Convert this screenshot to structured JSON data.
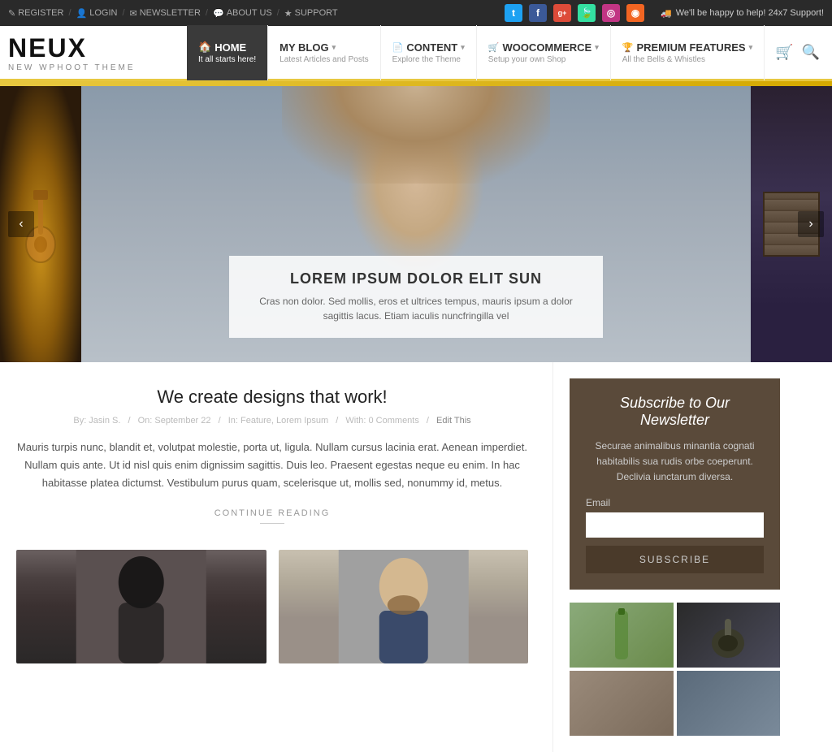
{
  "topbar": {
    "links": [
      {
        "label": "REGISTER",
        "icon": "✎"
      },
      {
        "label": "LOGIN",
        "icon": "👤"
      },
      {
        "label": "NEWSLETTER",
        "icon": "✉"
      },
      {
        "label": "ABOUT US",
        "icon": "💬"
      },
      {
        "label": "SUPPORT",
        "icon": "★"
      }
    ],
    "social": [
      {
        "name": "twitter",
        "icon": "t",
        "class": "si-twitter"
      },
      {
        "name": "facebook",
        "icon": "f",
        "class": "si-facebook"
      },
      {
        "name": "google",
        "icon": "g+",
        "class": "si-google"
      },
      {
        "name": "tripadvisor",
        "icon": "🍃",
        "class": "si-tripadvisor"
      },
      {
        "name": "instagram",
        "icon": "◎",
        "class": "si-instagram"
      },
      {
        "name": "rss",
        "icon": "◉",
        "class": "si-rss"
      }
    ],
    "support_text": "We'll be happy to help! 24x7 Support!"
  },
  "nav": {
    "logo": "NEUX",
    "tagline": "NEW WPHOOT THEME",
    "items": [
      {
        "label": "HOME",
        "sub": "It all starts here!",
        "active": true,
        "icon": "🏠"
      },
      {
        "label": "MY BLOG",
        "sub": "Latest Articles and Posts",
        "dropdown": true,
        "icon": ""
      },
      {
        "label": "CONTENT",
        "sub": "Explore the Theme",
        "dropdown": true,
        "icon": "📄"
      },
      {
        "label": "WOOCOMMERCE",
        "sub": "Setup your own Shop",
        "dropdown": true,
        "icon": "🛒"
      },
      {
        "label": "PREMIUM FEATURES",
        "sub": "All the Bells & Whistles",
        "dropdown": true,
        "icon": "🏆"
      }
    ]
  },
  "hero": {
    "title": "LOREM IPSUM DOLOR ELIT SUN",
    "description": "Cras non dolor. Sed mollis, eros et ultrices tempus, mauris ipsum a dolor sagittis lacus. Etiam iaculis nuncfringilla vel"
  },
  "article": {
    "title": "We create designs that work!",
    "meta": {
      "author": "By: Jasin S.",
      "date": "On: September 22",
      "category": "In: Feature, Lorem Ipsum",
      "comments": "With: 0 Comments",
      "edit": "Edit This"
    },
    "body": "Mauris turpis nunc, blandit et, volutpat molestie, porta ut, ligula. Nullam cursus lacinia erat. Aenean imperdiet. Nullam quis ante. Ut id nisl quis enim dignissim sagittis. Duis leo. Praesent egestas neque eu enim. In hac habitasse platea dictumst. Vestibulum purus quam, scelerisque ut, mollis sed, nonummy id, metus.",
    "continue_label": "CONTINUE READING"
  },
  "newsletter": {
    "title": "Subscribe to Our Newsletter",
    "description": "Securae animalibus minantia cognati habitabilis sua rudis orbe coeperunt. Declivia iunctarum diversa.",
    "email_label": "Email",
    "email_placeholder": "",
    "button_label": "SUBSCRIBE"
  },
  "icons": {
    "cart": "🛒",
    "search": "🔍",
    "prev_arrow": "‹",
    "next_arrow": "›",
    "truck_icon": "🚚"
  }
}
